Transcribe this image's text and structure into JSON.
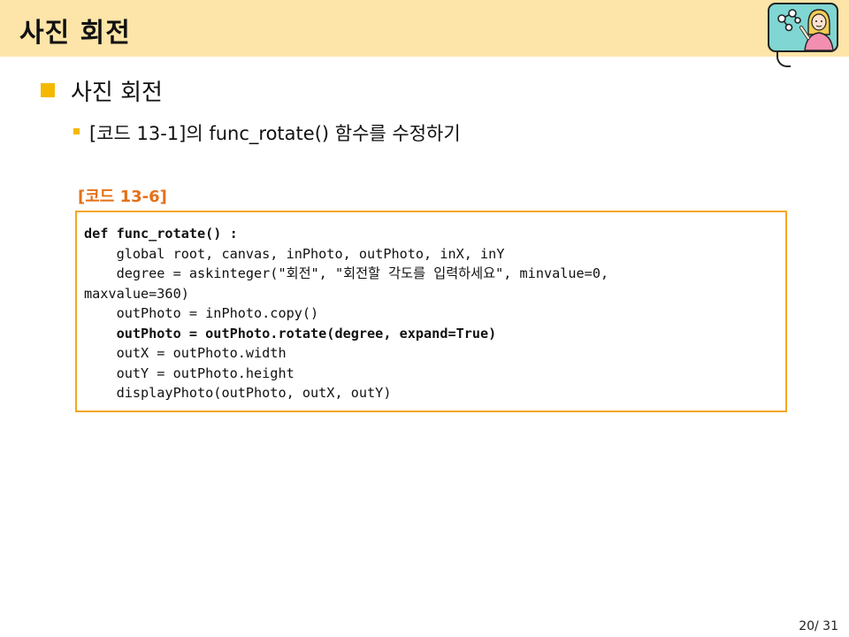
{
  "header": {
    "title": "사진 회전",
    "bg_color": "#fde4a8"
  },
  "presenter_icon": "presenter-illustration-icon",
  "section": {
    "heading": "사진 회전",
    "bullet_color": "#f5b800",
    "subpoint": "[코드 13-1]의 func_rotate() 함수를 수정하기"
  },
  "code": {
    "caption": "[코드 13-6]",
    "caption_color": "#e57018",
    "border_color": "#f5a623",
    "lines": [
      "def func_rotate() :",
      "    global root, canvas, inPhoto, outPhoto, inX, inY",
      "    degree = askinteger(\"회전\", \"회전할 각도를 입력하세요\", minvalue=0,",
      "maxvalue=360)",
      "    outPhoto = inPhoto.copy()",
      "    outPhoto = outPhoto.rotate(degree, expand=True)",
      "    outX = outPhoto.width",
      "    outY = outPhoto.height",
      "    displayPhoto(outPhoto, outX, outY)"
    ]
  },
  "footer": {
    "page_number": "20/ 31"
  }
}
